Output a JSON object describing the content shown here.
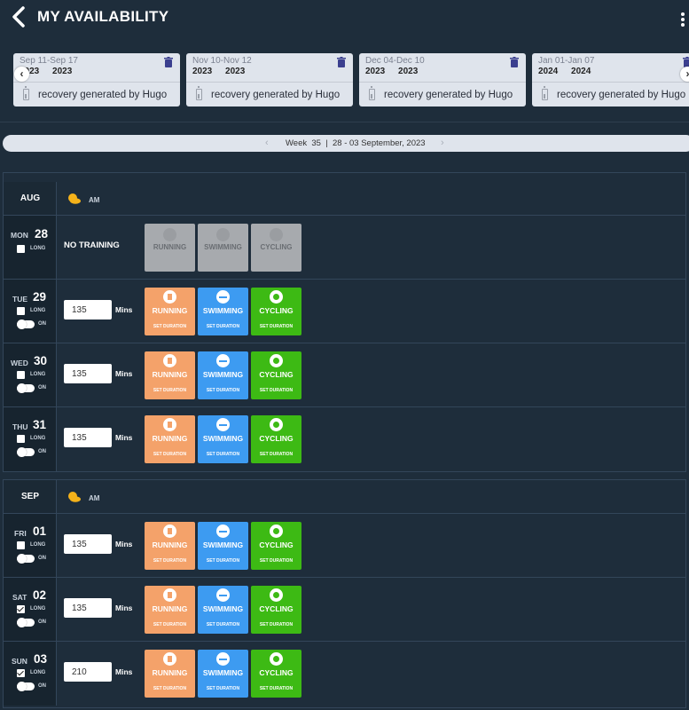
{
  "header": {
    "title": "MY AVAILABILITY"
  },
  "plans": [
    {
      "range": "Sep 11-Sep 17",
      "years": "2023 2023",
      "label": "recovery generated by Hugo"
    },
    {
      "range": "Nov 10-Nov 12",
      "years": "2023 2023",
      "label": "recovery generated by Hugo"
    },
    {
      "range": "Dec 04-Dec 10",
      "years": "2023 2023",
      "label": "recovery generated by Hugo"
    },
    {
      "range": "Jan 01-Jan 07",
      "years": "2024 2024",
      "label": "recovery generated by Hugo"
    }
  ],
  "week": {
    "text": "Week  35  |  28 - 03 September, 2023"
  },
  "labels": {
    "am": "AM",
    "long": "LONG",
    "on": "ON",
    "mins": "Mins",
    "no_training": "NO TRAINING",
    "set_duration": "SET DURATION",
    "running": "RUNNING",
    "swimming": "SWIMMING",
    "cycling": "CYCLING"
  },
  "months": [
    {
      "name": "AUG"
    },
    {
      "name": "SEP"
    }
  ],
  "days": [
    {
      "day": "MON",
      "num": "28",
      "long": false,
      "training": false,
      "minutes": ""
    },
    {
      "day": "TUE",
      "num": "29",
      "long": false,
      "training": true,
      "minutes": "135"
    },
    {
      "day": "WED",
      "num": "30",
      "long": false,
      "training": true,
      "minutes": "135"
    },
    {
      "day": "THU",
      "num": "31",
      "long": false,
      "training": true,
      "minutes": "135"
    },
    {
      "day": "FRI",
      "num": "01",
      "long": false,
      "training": true,
      "minutes": "135"
    },
    {
      "day": "SAT",
      "num": "02",
      "long": true,
      "training": true,
      "minutes": "135"
    },
    {
      "day": "SUN",
      "num": "03",
      "long": true,
      "training": true,
      "minutes": "210"
    }
  ],
  "colors": {
    "running": "#f4a26a",
    "swimming": "#3d9bf1",
    "cycling": "#3dba14",
    "disabled": "#a7aaae"
  }
}
